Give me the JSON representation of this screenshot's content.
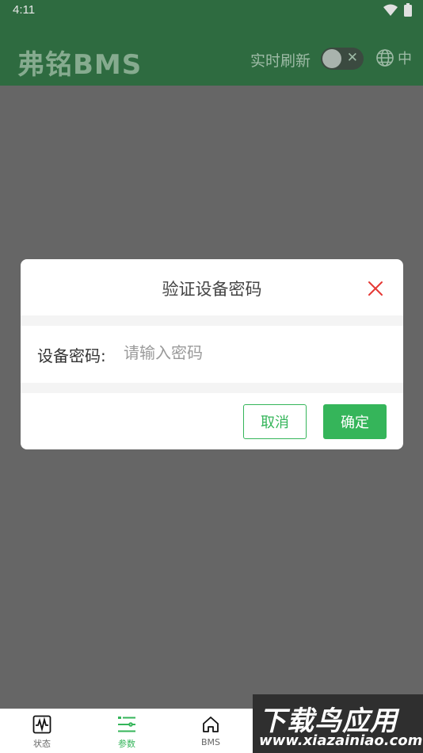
{
  "status_bar": {
    "time": "4:11"
  },
  "app_bar": {
    "title": "弗铭BMS",
    "realtime_label": "实时刷新",
    "toggle_symbol": "✕",
    "language": "中"
  },
  "dialog": {
    "title": "验证设备密码",
    "field_label": "设备密码:",
    "password_placeholder": "请输入密码",
    "password_value": "",
    "cancel_label": "取消",
    "ok_label": "确定"
  },
  "bottom_nav": {
    "items": [
      {
        "label": "状态",
        "icon": "waveform-icon",
        "active": false
      },
      {
        "label": "参数",
        "icon": "list-settings-icon",
        "active": true
      },
      {
        "label": "BMS",
        "icon": "home-icon",
        "active": false
      }
    ]
  },
  "watermark": {
    "main": "下载鸟应用",
    "url": "www.xiazainiao.com"
  },
  "colors": {
    "accent": "#35b55a",
    "app_bar_dimmed": "#2e6b40",
    "overlay": "#666666",
    "close_icon": "#e53935"
  }
}
